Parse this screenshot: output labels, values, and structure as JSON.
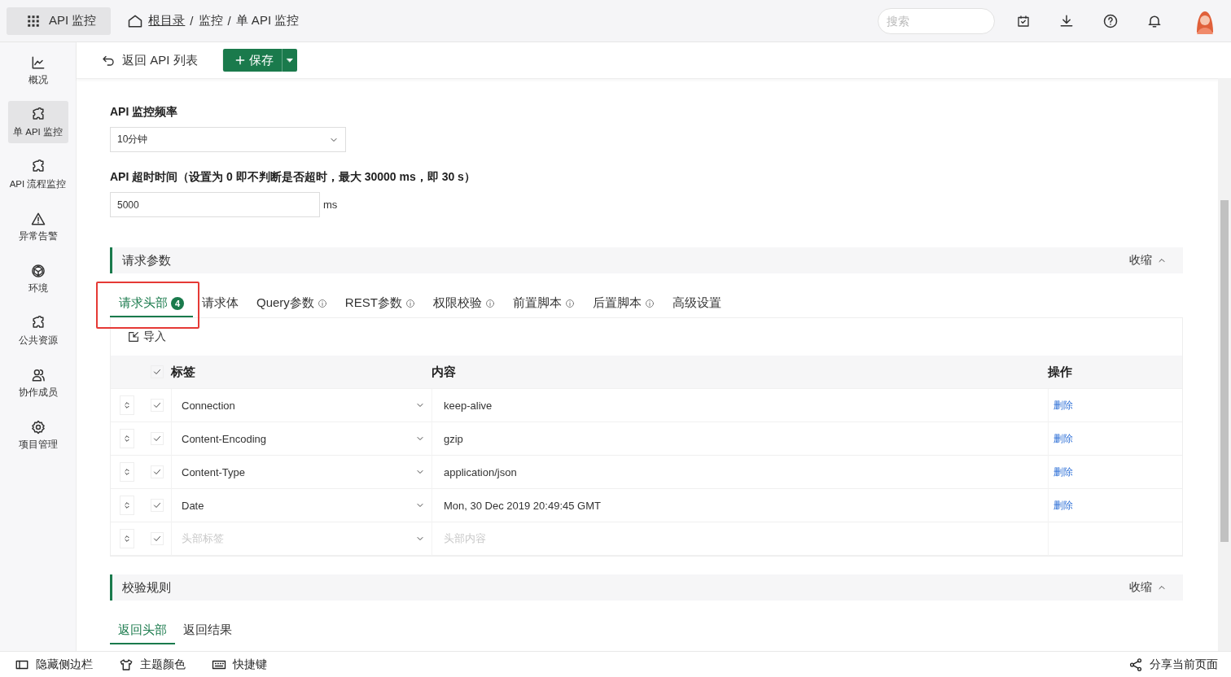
{
  "app": {
    "title": "API 监控"
  },
  "breadcrumb": [
    {
      "kind": "link",
      "text": "根目录"
    },
    {
      "kind": "sep",
      "text": "/"
    },
    {
      "kind": "text",
      "text": "监控"
    },
    {
      "kind": "sep",
      "text": "/"
    },
    {
      "kind": "text",
      "text": "单 API 监控"
    }
  ],
  "search": {
    "placeholder": "搜索"
  },
  "sidebar": {
    "items": [
      {
        "label": "概况",
        "kind": "chart",
        "selected": false
      },
      {
        "label": "单 API 监控",
        "kind": "puzzle",
        "selected": true
      },
      {
        "label": "API 流程监控",
        "kind": "puzzle",
        "selected": false
      },
      {
        "label": "异常告警",
        "kind": "warning",
        "selected": false
      },
      {
        "label": "环境",
        "kind": "cube",
        "selected": false
      },
      {
        "label": "公共资源",
        "kind": "puzzle",
        "selected": false
      },
      {
        "label": "协作成员",
        "kind": "people",
        "selected": false
      },
      {
        "label": "项目管理",
        "kind": "gear",
        "selected": false
      }
    ]
  },
  "toolbar": {
    "back": "返回 API 列表",
    "save": "保存"
  },
  "frequency": {
    "label": "API 监控频率",
    "value": "10分钟"
  },
  "timeout": {
    "label": "API 超时时间（设置为 0 即不判断是否超时，最大 30000 ms，即 30 s）",
    "value": "5000",
    "unit": "ms"
  },
  "request_section": {
    "title": "请求参数",
    "toggle": "收缩",
    "tabs": [
      {
        "label": "请求头部",
        "badge": "4",
        "info": false,
        "selected": true,
        "highlighted": true
      },
      {
        "label": "请求体",
        "info": false,
        "selected": false,
        "highlighted": false
      },
      {
        "label": "Query参数",
        "info": true,
        "selected": false,
        "highlighted": false
      },
      {
        "label": "REST参数",
        "info": true,
        "selected": false,
        "highlighted": false
      },
      {
        "label": "权限校验",
        "info": true,
        "selected": false,
        "highlighted": false
      },
      {
        "label": "前置脚本",
        "info": true,
        "selected": false,
        "highlighted": false
      },
      {
        "label": "后置脚本",
        "info": true,
        "selected": false,
        "highlighted": false
      },
      {
        "label": "高级设置",
        "info": false,
        "selected": false,
        "highlighted": false
      }
    ],
    "import": "导入",
    "table": {
      "columns": [
        "标签",
        "内容",
        "操作"
      ],
      "header_checked": true,
      "rows": [
        {
          "label": "Connection",
          "value": "keep-alive",
          "action": "删除",
          "checked": true
        },
        {
          "label": "Content-Encoding",
          "value": "gzip",
          "action": "删除",
          "checked": true
        },
        {
          "label": "Content-Type",
          "value": "application/json",
          "action": "删除",
          "checked": true
        },
        {
          "label": "Date",
          "value": "Mon, 30 Dec 2019 20:49:45 GMT",
          "action": "删除",
          "checked": true
        },
        {
          "label_placeholder": "头部标签",
          "value_placeholder": "头部内容",
          "checked": true
        }
      ]
    }
  },
  "validation_section": {
    "title": "校验规则",
    "toggle": "收缩",
    "tabs": [
      {
        "label": "返回头部",
        "selected": true
      },
      {
        "label": "返回结果",
        "selected": false
      }
    ]
  },
  "footer": {
    "items": [
      {
        "label": "隐藏侧边栏",
        "kind": "sidebar"
      },
      {
        "label": "主题颜色",
        "kind": "shirt"
      },
      {
        "label": "快捷键",
        "kind": "keyboard"
      }
    ],
    "share": "分享当前页面"
  }
}
